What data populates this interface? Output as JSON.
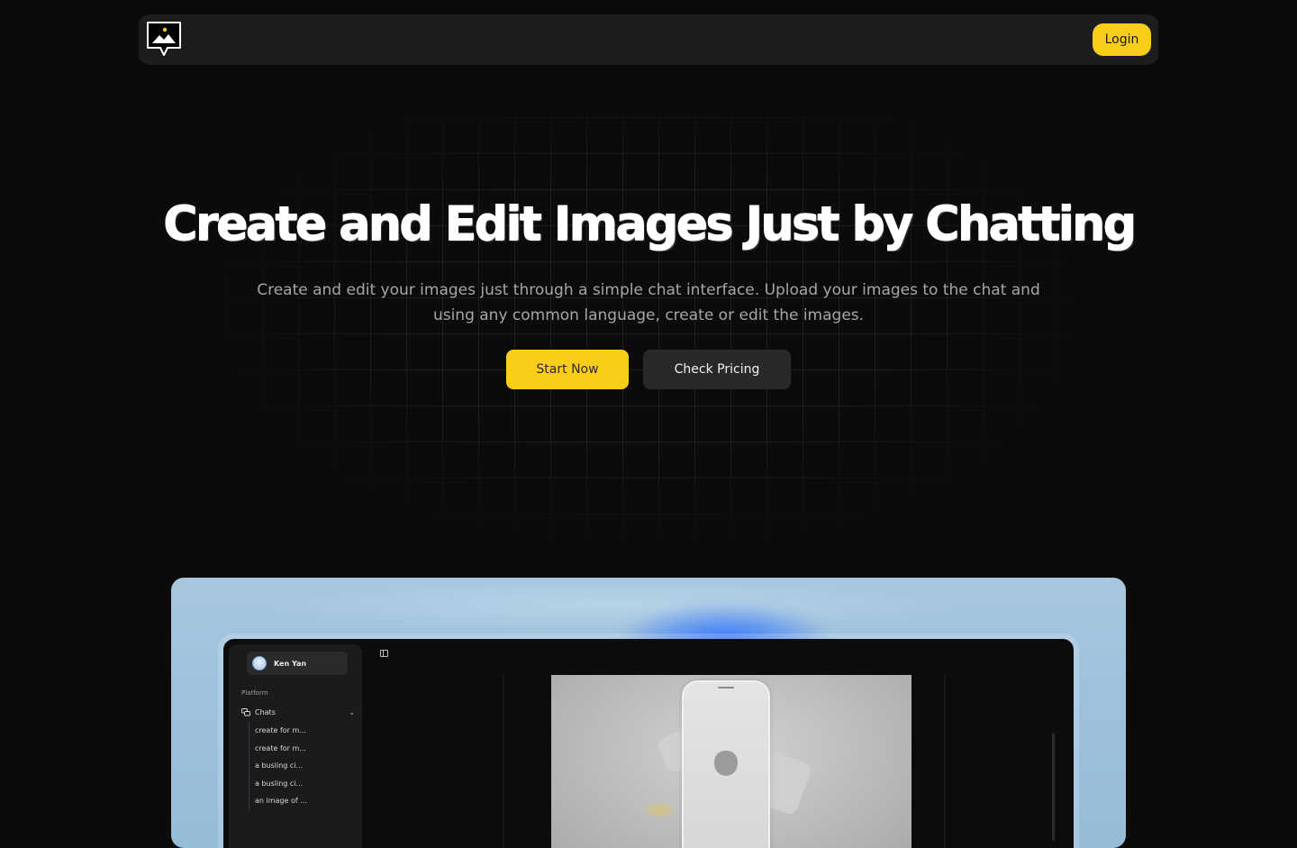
{
  "nav": {
    "logo_icon": "image-chat-logo-icon",
    "login_label": "Login"
  },
  "hero": {
    "title": "Create and Edit Images Just by Chatting",
    "subtitle": "Create and edit your images just through a simple chat interface. Upload your images to the chat and using any common language, create or edit the images.",
    "primary_cta": "Start Now",
    "secondary_cta": "Check Pricing"
  },
  "preview": {
    "user": {
      "name": "Ken Yan",
      "avatar_icon": "avatar-icon"
    },
    "section_label": "Platform",
    "chats_label": "Chats",
    "chats_icon": "chat-bubbles-icon",
    "chevron_icon": "chevron-down-icon",
    "chat_items": [
      "create for m...",
      "create for m...",
      "a busling ci...",
      "a busling ci...",
      "an image of ..."
    ],
    "sidebar_toggle_icon": "sidebar-toggle-icon"
  },
  "colors": {
    "background": "#0b0b0b",
    "navbar": "#1c1c1c",
    "accent": "#fbcd1b",
    "secondary_button": "#2a2929",
    "subtitle": "#a6a6a6"
  }
}
